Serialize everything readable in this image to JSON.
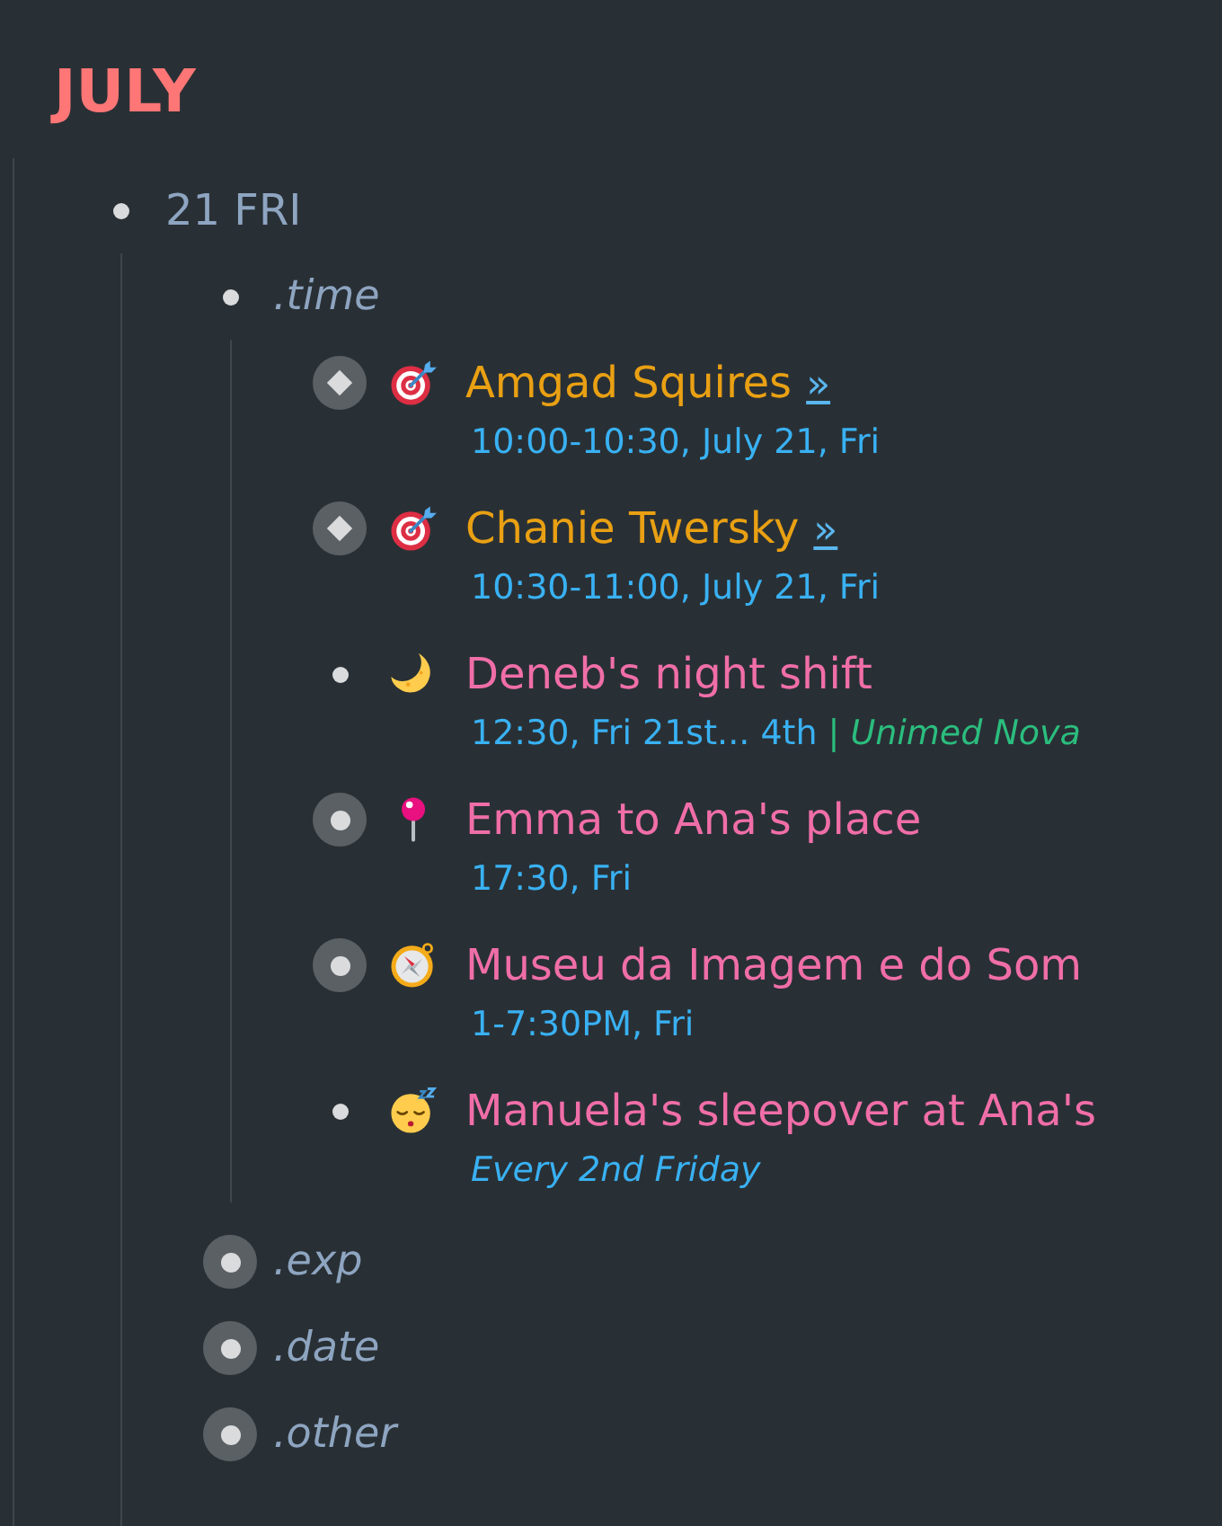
{
  "heading": "JULY",
  "outline": [
    {
      "label": "21 FRI",
      "bullet": {
        "kind": "dot",
        "collapsed": false
      },
      "children": [
        {
          "label": ".time",
          "bullet": {
            "kind": "dot",
            "collapsed": false
          },
          "children": [
            {
              "kind": "target",
              "bullet": {
                "kind": "diamond",
                "collapsed": true
              },
              "title": "Amgad Squires",
              "color": "#e9a013",
              "link": "»",
              "when": {
                "kind": "date",
                "text": "10:00-10:30, July 21, Fri"
              }
            },
            {
              "kind": "target",
              "bullet": {
                "kind": "diamond",
                "collapsed": true
              },
              "title": "Chanie Twersky",
              "color": "#e9a013",
              "link": "»",
              "when": {
                "kind": "date",
                "text": "10:30-11:00, July 21, Fri"
              }
            },
            {
              "kind": "moon",
              "bullet": {
                "kind": "dot",
                "collapsed": false
              },
              "title": "Deneb's night shift",
              "color": "#f06ea8",
              "when": {
                "kind": "date",
                "text": "12:30, Fri 21st... 4th"
              },
              "separator": "|",
              "place": "Unimed Nova"
            },
            {
              "kind": "pin",
              "bullet": {
                "kind": "dot",
                "collapsed": true
              },
              "title": "Emma to Ana's place",
              "color": "#f06ea8",
              "when": {
                "kind": "date",
                "text": "17:30, Fri"
              }
            },
            {
              "kind": "compass",
              "bullet": {
                "kind": "dot",
                "collapsed": true
              },
              "title": "Museu da Imagem e do Som",
              "color": "#f06ea8",
              "when": {
                "kind": "date",
                "text": "1-7:30PM, Fri"
              }
            },
            {
              "kind": "sleep",
              "bullet": {
                "kind": "dot",
                "collapsed": false
              },
              "title": "Manuela's sleepover at Ana's",
              "color": "#f06ea8",
              "when": {
                "kind": "recurrence",
                "text": "Every 2nd Friday"
              }
            }
          ]
        },
        {
          "label": ".exp",
          "bullet": {
            "kind": "dot",
            "collapsed": true
          }
        },
        {
          "label": ".date",
          "bullet": {
            "kind": "dot",
            "collapsed": true
          }
        },
        {
          "label": ".other",
          "bullet": {
            "kind": "dot",
            "collapsed": true
          }
        }
      ]
    }
  ]
}
